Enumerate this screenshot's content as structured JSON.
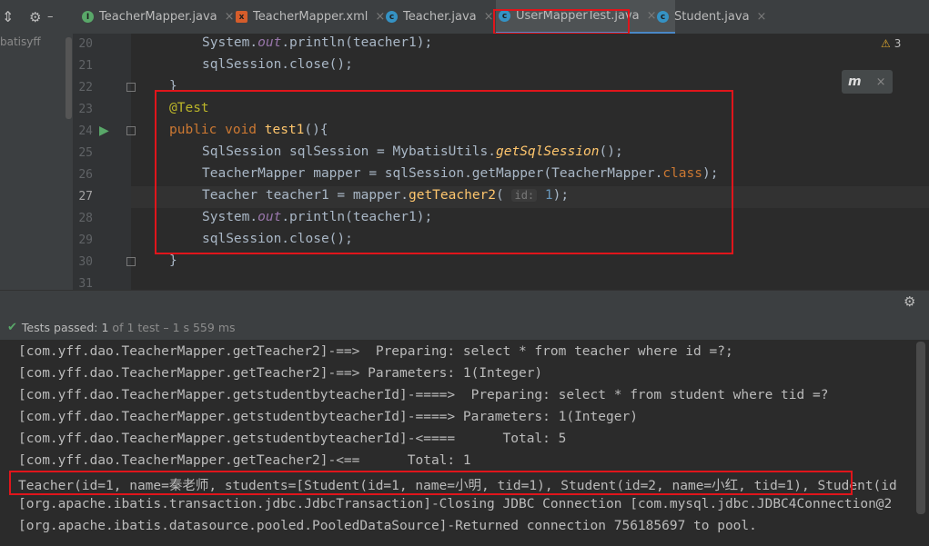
{
  "tabs": [
    {
      "label": "TeacherMapper.java",
      "color": "#59a869",
      "letter": "I"
    },
    {
      "label": "TeacherMapper.xml",
      "color": "#d55d2b",
      "letter": "x"
    },
    {
      "label": "Teacher.java",
      "color": "#3592c4",
      "letter": "c"
    },
    {
      "label": "UserMapperTest.java",
      "color": "#3592c4",
      "letter": "c"
    },
    {
      "label": "Student.java",
      "color": "#3592c4",
      "letter": "c"
    }
  ],
  "project": {
    "label": "batisyff"
  },
  "editor": {
    "warnings": "3",
    "line_numbers": [
      "20",
      "21",
      "22",
      "23",
      "24",
      "25",
      "26",
      "27",
      "28",
      "29",
      "30",
      "31"
    ],
    "lines": {
      "l20a": "System.",
      "l20b": "out",
      "l20c": ".println(teacher1);",
      "l21": "sqlSession.close();",
      "l22": "}",
      "l23": "@Test",
      "l24a": "public void ",
      "l24b": "test1",
      "l24c": "(){",
      "l25a": "SqlSession sqlSession = MybatisUtils.",
      "l25b": "getSqlSession",
      "l25c": "();",
      "l26a": "TeacherMapper mapper = sqlSession.getMapper(TeacherMapper.",
      "l26b": "class",
      "l26c": ");",
      "l27a": "Teacher teacher1 = mapper.",
      "l27b": "getTeacher2",
      "l27c": "(",
      "l27hint": "id:",
      "l27num": "1",
      "l27d": ");",
      "l28a": "System.",
      "l28b": "out",
      "l28c": ".println(teacher1);",
      "l29": "sqlSession.close();",
      "l30": "}"
    }
  },
  "status": {
    "passed": "Tests passed:",
    "count": "1",
    "rest": "of 1 test – 1 s 559 ms"
  },
  "console": [
    "[com.yff.dao.TeacherMapper.getTeacher2]-==>  Preparing: select * from teacher where id =?;",
    "[com.yff.dao.TeacherMapper.getTeacher2]-==> Parameters: 1(Integer)",
    "[com.yff.dao.TeacherMapper.getstudentbyteacherId]-====>  Preparing: select * from student where tid =?",
    "[com.yff.dao.TeacherMapper.getstudentbyteacherId]-====> Parameters: 1(Integer)",
    "[com.yff.dao.TeacherMapper.getstudentbyteacherId]-<====      Total: 5",
    "[com.yff.dao.TeacherMapper.getTeacher2]-<==      Total: 1",
    "Teacher(id=1, name=秦老师, students=[Student(id=1, name=小明, tid=1), Student(id=2, name=小红, tid=1), Student(id",
    "[org.apache.ibatis.transaction.jdbc.JdbcTransaction]-Closing JDBC Connection [com.mysql.jdbc.JDBC4Connection@2",
    "[org.apache.ibatis.datasource.pooled.PooledDataSource]-Returned connection 756185697 to pool."
  ]
}
